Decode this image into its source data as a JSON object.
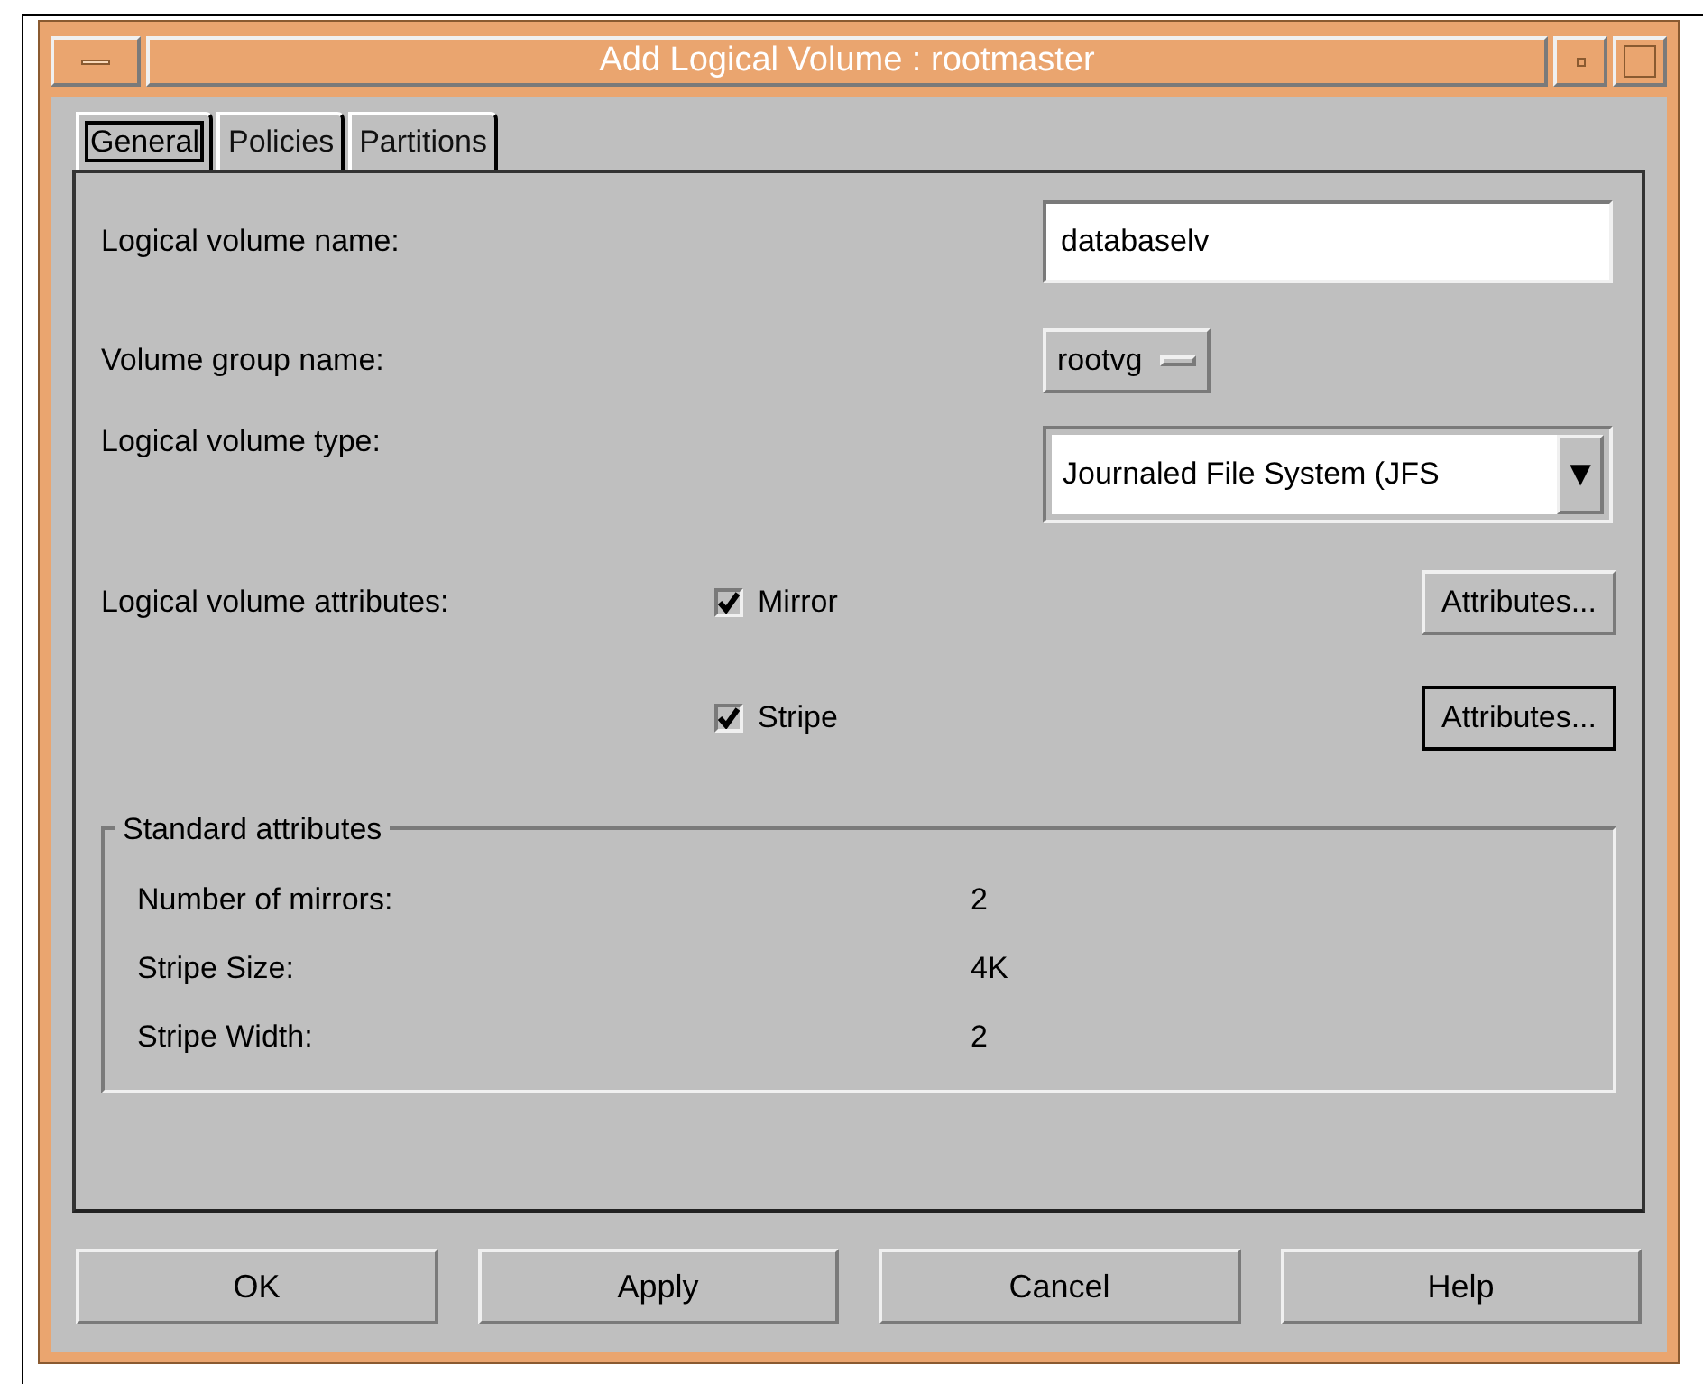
{
  "window": {
    "title": "Add Logical Volume : rootmaster"
  },
  "tabs": [
    {
      "label": "General",
      "selected": true
    },
    {
      "label": "Policies",
      "selected": false
    },
    {
      "label": "Partitions",
      "selected": false
    }
  ],
  "form": {
    "lv_name": {
      "label": "Logical volume name:",
      "value": "databaselv"
    },
    "vg_name": {
      "label": "Volume group name:",
      "value": "rootvg"
    },
    "lv_type": {
      "label": "Logical volume type:",
      "value": "Journaled File System (JFS",
      "arrow": "▼"
    },
    "attributes_label": "Logical volume attributes:",
    "attributes": [
      {
        "label": "Mirror",
        "checked": true,
        "button": "Attributes...",
        "focused": false
      },
      {
        "label": "Stripe",
        "checked": true,
        "button": "Attributes...",
        "focused": true
      }
    ]
  },
  "standard_attributes": {
    "title": "Standard attributes",
    "rows": [
      {
        "label": "Number of mirrors:",
        "value": "2"
      },
      {
        "label": "Stripe Size:",
        "value": "4K"
      },
      {
        "label": "Stripe Width:",
        "value": "2"
      }
    ]
  },
  "buttons": [
    "OK",
    "Apply",
    "Cancel",
    "Help"
  ]
}
